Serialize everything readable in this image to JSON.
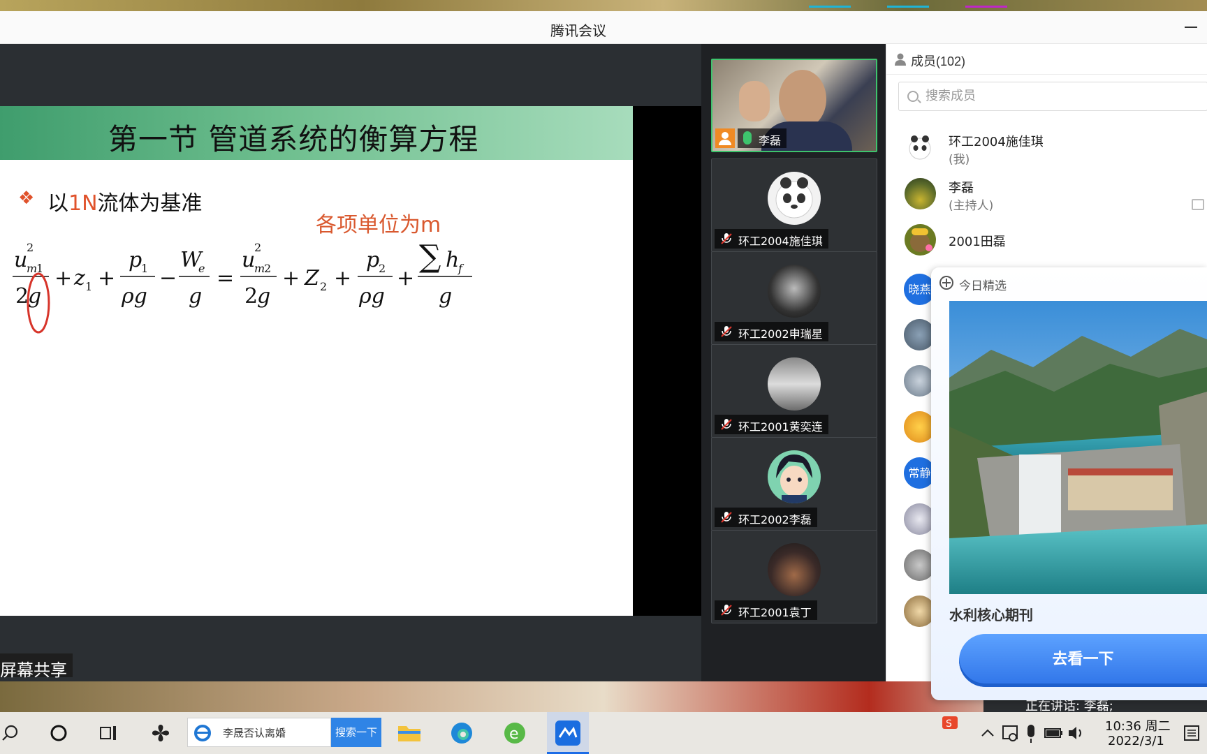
{
  "window": {
    "title": "腾讯会议"
  },
  "slide": {
    "title": "第一节 管道系统的衡算方程",
    "bullet_marker": "❖",
    "bullet_prefix": "以",
    "bullet_highlight": "1N",
    "bullet_suffix": "流体为基准",
    "unit_note": "各项单位为m"
  },
  "screen_share_label": "屏幕共享",
  "video_tiles": [
    {
      "name": "李磊",
      "mic": "on",
      "active": true
    },
    {
      "name": "环工2004施佳琪",
      "mic": "off"
    },
    {
      "name": "环工2002申瑞星",
      "mic": "off"
    },
    {
      "name": "环工2001黄奕连",
      "mic": "off"
    },
    {
      "name": "环工2002李磊",
      "mic": "off"
    },
    {
      "name": "环工2001袁丁",
      "mic": "off"
    }
  ],
  "members": {
    "title": "成员(102)",
    "search_placeholder": "搜索成员",
    "list": [
      {
        "name": "环工2004施佳琪",
        "role": "(我)"
      },
      {
        "name": "李磊",
        "role": "(主持人)"
      },
      {
        "name": "2001田磊",
        "role": ""
      }
    ],
    "partial_avatars": [
      "晓燕",
      "常静"
    ]
  },
  "popup": {
    "title": "今日精选",
    "caption": "水利核心期刊",
    "button_label": "去看一下"
  },
  "speaking_status": "正在讲话: 李磊;",
  "taskbar": {
    "search_text": "李晟否认离婚",
    "search_button": "搜索一下",
    "time": "10:36 周二",
    "date": "2022/3/1"
  },
  "colors": {
    "accent_green": "#3ec46d",
    "host_orange": "#f08a24",
    "slide_red": "#e0522b",
    "button_blue": "#2f74e8"
  },
  "icons": [
    "search-icon",
    "person-icon",
    "mic-off-icon",
    "mic-on-icon",
    "host-icon",
    "add-circle-icon",
    "message-icon",
    "windows-search-icon",
    "cortana-icon",
    "task-view-icon",
    "file-explorer-icon",
    "edge-icon",
    "ie-icon",
    "tencent-meeting-icon",
    "wps-icon",
    "tray-up-icon",
    "volume-icon",
    "battery-icon",
    "notification-icon"
  ]
}
